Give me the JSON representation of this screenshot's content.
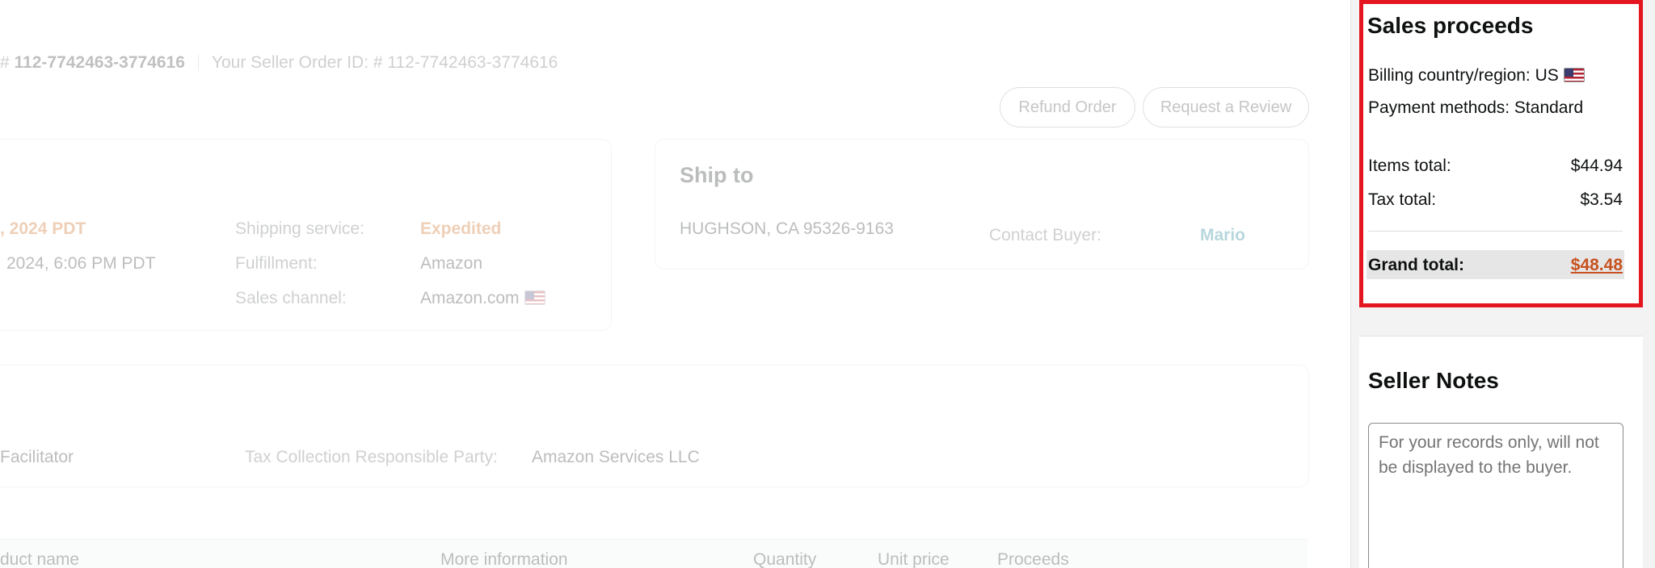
{
  "header": {
    "order_id": "112-7742463-3774616",
    "order_prefix": "# ",
    "seller_order_label": "Your Seller Order ID: # 112-7742463-3774616"
  },
  "actions": {
    "refund": "Refund Order",
    "review": "Request a Review"
  },
  "order_details": {
    "date_partial": ", 2024 PDT",
    "date_partial_2": "2024, 6:06 PM PDT",
    "shipping_service_label": "Shipping service:",
    "shipping_service_value": "Expedited",
    "fulfillment_label": "Fulfillment:",
    "fulfillment_value": "Amazon",
    "sales_channel_label": "Sales channel:",
    "sales_channel_value": "Amazon.com"
  },
  "ship_to": {
    "title": "Ship to",
    "address": "HUGHSON, CA 95326-9163",
    "contact_label": "Contact Buyer:",
    "contact_name": "Mario"
  },
  "tax_info": {
    "facilitator": "Facilitator",
    "responsible_label": "Tax Collection Responsible Party:",
    "responsible_value": "Amazon Services LLC"
  },
  "table": {
    "columns": [
      "duct name",
      "More information",
      "Quantity",
      "Unit price",
      "Proceeds"
    ]
  },
  "sales_proceeds": {
    "title": "Sales proceeds",
    "billing": "Billing country/region: US",
    "payment": "Payment methods: Standard",
    "items_label": "Items total:",
    "items_value": "$44.94",
    "tax_label": "Tax total:",
    "tax_value": "$3.54",
    "grand_label": "Grand total:",
    "grand_value": "$48.48"
  },
  "seller_notes": {
    "title": "Seller Notes",
    "placeholder": "For your records only, will not be displayed to the buyer."
  },
  "colors": {
    "highlight_border": "#e4161f",
    "grand_total": "#c7511f",
    "link": "#007185",
    "orange": "#c45500"
  },
  "icons": {
    "flag": "us-flag-icon"
  }
}
